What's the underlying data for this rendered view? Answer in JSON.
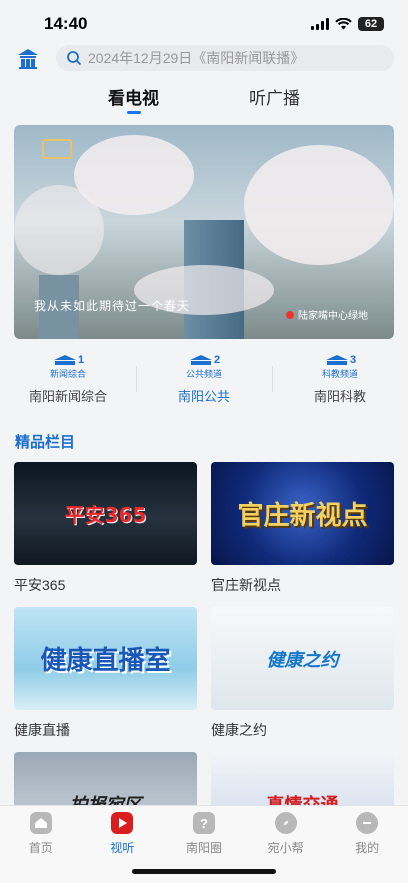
{
  "status": {
    "time": "14:40",
    "battery": "62"
  },
  "search": {
    "placeholder": "2024年12月29日《南阳新闻联播》"
  },
  "tabs": [
    {
      "label": "看电视",
      "active": true
    },
    {
      "label": "听广播",
      "active": false
    }
  ],
  "banner": {
    "caption": "我从未如此期待过一个春天",
    "location": "陆家嘴中心绿地"
  },
  "channels": [
    {
      "number": "1",
      "sub": "新闻综合",
      "name": "南阳新闻综合",
      "active": false
    },
    {
      "number": "2",
      "sub": "公共频道",
      "name": "南阳公共",
      "active": true
    },
    {
      "number": "3",
      "sub": "科教频道",
      "name": "南阳科教",
      "active": false
    }
  ],
  "section": {
    "title": "精品栏目"
  },
  "programs": [
    {
      "title": "平安365",
      "thumb_text": "平安365"
    },
    {
      "title": "官庄新视点",
      "thumb_text": "官庄新视点"
    },
    {
      "title": "健康直播",
      "thumb_text": "健康直播室"
    },
    {
      "title": "健康之约",
      "thumb_text": "健康之约"
    },
    {
      "title": "",
      "thumb_text": "拍报宛区"
    },
    {
      "title": "",
      "thumb_text": "真情交通"
    }
  ],
  "bottom_nav": [
    {
      "label": "首页",
      "icon": "home-icon",
      "active": false
    },
    {
      "label": "视听",
      "icon": "play-icon",
      "active": true
    },
    {
      "label": "南阳圈",
      "icon": "question-icon",
      "active": false
    },
    {
      "label": "宛小帮",
      "icon": "compass-icon",
      "active": false
    },
    {
      "label": "我的",
      "icon": "profile-icon",
      "active": false
    }
  ],
  "colors": {
    "accent": "#1a6fd0",
    "active_icon": "#d81e1e"
  }
}
